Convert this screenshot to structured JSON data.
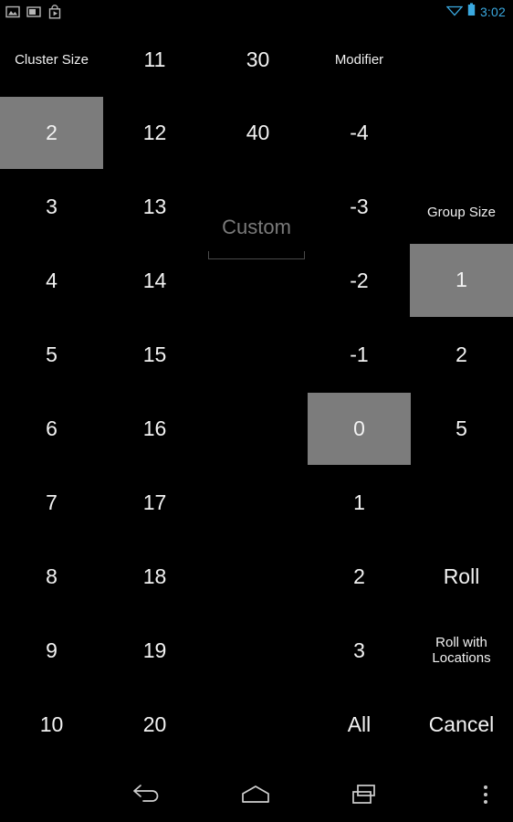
{
  "status_bar": {
    "notification_icons": [
      "image-icon",
      "screenshot-icon",
      "play-store-icon"
    ],
    "wifi_icon": "wifi-icon",
    "battery_icon": "battery-icon",
    "time": "3:02",
    "accent_color": "#3aa9e0"
  },
  "dialog": {
    "selected_color": "#7c7c7c",
    "text_color": "#f2f2f2",
    "placeholder_color": "#7a7a7a",
    "background_color": "#000000"
  },
  "columns": {
    "cluster_size_a": {
      "header": "Cluster Size",
      "items": [
        {
          "label": "2",
          "selected": true
        },
        {
          "label": "3",
          "selected": false
        },
        {
          "label": "4",
          "selected": false
        },
        {
          "label": "5",
          "selected": false
        },
        {
          "label": "6",
          "selected": false
        },
        {
          "label": "7",
          "selected": false
        },
        {
          "label": "8",
          "selected": false
        },
        {
          "label": "9",
          "selected": false
        },
        {
          "label": "10",
          "selected": false
        }
      ]
    },
    "cluster_size_b": {
      "items": [
        {
          "label": "11",
          "selected": false
        },
        {
          "label": "12",
          "selected": false
        },
        {
          "label": "13",
          "selected": false
        },
        {
          "label": "14",
          "selected": false
        },
        {
          "label": "15",
          "selected": false
        },
        {
          "label": "16",
          "selected": false
        },
        {
          "label": "17",
          "selected": false
        },
        {
          "label": "18",
          "selected": false
        },
        {
          "label": "19",
          "selected": false
        },
        {
          "label": "20",
          "selected": false
        }
      ]
    },
    "cluster_size_c": {
      "items": [
        {
          "label": "30",
          "selected": false
        },
        {
          "label": "40",
          "selected": false
        }
      ],
      "custom_input": {
        "placeholder": "Custom",
        "value": ""
      }
    },
    "modifier": {
      "header": "Modifier",
      "items": [
        {
          "label": "-4",
          "selected": false
        },
        {
          "label": "-3",
          "selected": false
        },
        {
          "label": "-2",
          "selected": false
        },
        {
          "label": "-1",
          "selected": false
        },
        {
          "label": "0",
          "selected": true
        },
        {
          "label": "1",
          "selected": false
        },
        {
          "label": "2",
          "selected": false
        },
        {
          "label": "3",
          "selected": false
        },
        {
          "label": "All",
          "selected": false
        }
      ]
    },
    "group_size": {
      "header": "Group Size",
      "items": [
        {
          "label": "1",
          "selected": true
        },
        {
          "label": "2",
          "selected": false
        },
        {
          "label": "5",
          "selected": false
        }
      ]
    }
  },
  "actions": {
    "roll": "Roll",
    "roll_with_locations": "Roll with\nLocations",
    "roll_with_locations_line1": "Roll with",
    "roll_with_locations_line2": "Locations",
    "cancel": "Cancel"
  },
  "nav_bar": {
    "back": "back-icon",
    "home": "home-icon",
    "recents": "recents-icon",
    "overflow": "overflow-menu-icon"
  }
}
